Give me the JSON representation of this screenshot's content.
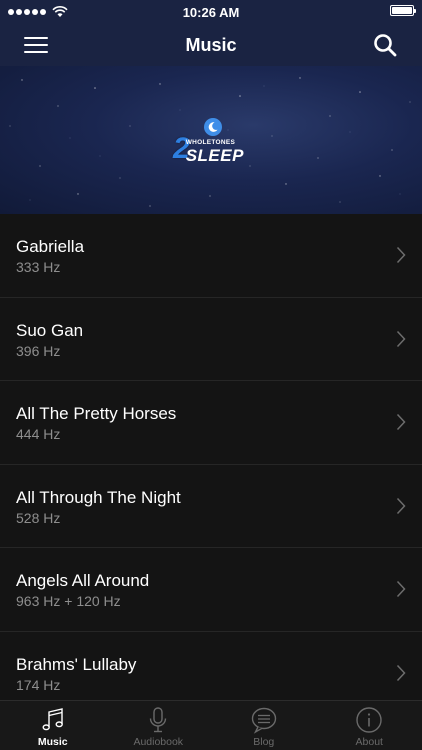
{
  "status_bar": {
    "time": "10:26 AM"
  },
  "nav": {
    "title": "Music",
    "menu_icon": "hamburger-menu-icon",
    "search_icon": "search-icon"
  },
  "hero": {
    "logo": {
      "number": "2",
      "small_text": "WHOLETONES",
      "big_text": "SLEEP",
      "moon_icon": "moon-icon"
    }
  },
  "tracks": [
    {
      "title": "Gabriella",
      "freq": "333 Hz"
    },
    {
      "title": "Suo Gan",
      "freq": "396 Hz"
    },
    {
      "title": "All The Pretty Horses",
      "freq": "444 Hz"
    },
    {
      "title": "All Through The Night",
      "freq": "528 Hz"
    },
    {
      "title": "Angels All Around",
      "freq": "963 Hz + 120 Hz"
    },
    {
      "title": "Brahms' Lullaby",
      "freq": "174 Hz"
    }
  ],
  "tabs": [
    {
      "label": "Music",
      "icon": "music-note-icon",
      "active": true
    },
    {
      "label": "Audiobook",
      "icon": "microphone-icon",
      "active": false
    },
    {
      "label": "Blog",
      "icon": "chat-bubble-icon",
      "active": false
    },
    {
      "label": "About",
      "icon": "info-icon",
      "active": false
    }
  ],
  "colors": {
    "nav_bg": "#1a2342",
    "list_bg": "#141414",
    "accent_blue": "#2d7fe0",
    "muted_text": "#8e8e8e"
  }
}
